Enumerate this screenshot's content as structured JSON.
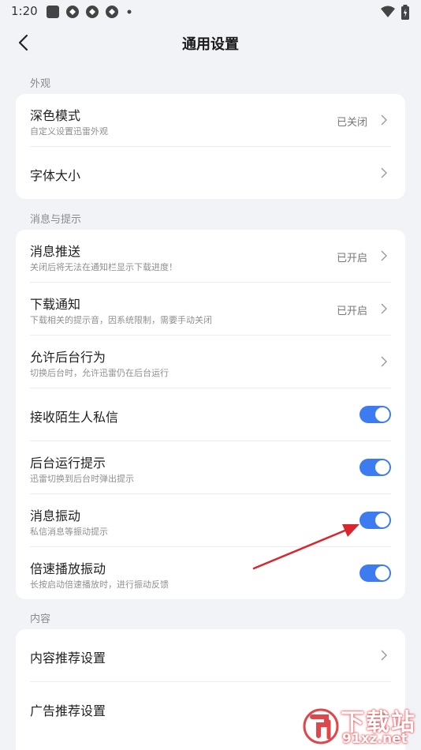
{
  "status_bar": {
    "time": "1:20",
    "icons": [
      "square-icon",
      "app-icon",
      "app-icon",
      "app-icon",
      "dot-icon"
    ],
    "right_icons": [
      "wifi-icon",
      "battery-icon"
    ]
  },
  "header": {
    "title": "通用设置",
    "back_icon": "back-arrow-icon"
  },
  "sections": {
    "appearance": {
      "label": "外观",
      "dark_mode": {
        "title": "深色模式",
        "subtitle": "自定义设置迅雷外观",
        "value": "已关闭"
      },
      "font_size": {
        "title": "字体大小"
      }
    },
    "messages": {
      "label": "消息与提示",
      "push": {
        "title": "消息推送",
        "subtitle": "关闭后将无法在通知栏显示下载进度！",
        "value": "已开启"
      },
      "download_notice": {
        "title": "下载通知",
        "subtitle": "下载相关的提示音，因系统限制，需要手动关闭",
        "value": "已开启"
      },
      "background": {
        "title": "允许后台行为",
        "subtitle": "切换后台时，允许迅雷仍在后台运行"
      },
      "stranger_msg": {
        "title": "接收陌生人私信",
        "enabled": true
      },
      "bg_run_tip": {
        "title": "后台运行提示",
        "subtitle": "迅雷切换到后台时弹出提示",
        "enabled": true
      },
      "vibrate": {
        "title": "消息振动",
        "subtitle": "私信消息等振动提示",
        "enabled": true
      },
      "speed_vibrate": {
        "title": "倍速播放振动",
        "subtitle": "长按启动倍速播放时，进行振动反馈",
        "enabled": true
      }
    },
    "content": {
      "label": "内容",
      "recommend": {
        "title": "内容推荐设置"
      },
      "ad_recommend": {
        "title": "广告推荐设置"
      }
    }
  },
  "colors": {
    "toggle_on": "#3d7cf0",
    "annotation_arrow": "#d9262c",
    "background": "#f2f3f7"
  },
  "watermark": {
    "big": "下载站",
    "small": "91xz.net"
  }
}
